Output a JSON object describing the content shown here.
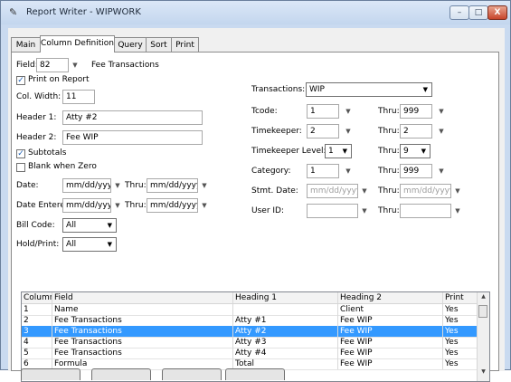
{
  "window": {
    "title": "Report Writer - WIPWORK",
    "min": "–",
    "max": "□",
    "close": "X"
  },
  "tabs": [
    "Main",
    "Column Definition",
    "Query",
    "Sort",
    "Print"
  ],
  "left": {
    "field_label": "Field:",
    "field_value": "82",
    "field_name": "Fee Transactions",
    "print_on_report": "Print on Report",
    "col_width_label": "Col. Width:",
    "col_width": "11",
    "header1_label": "Header 1:",
    "header1": "Atty #2",
    "header2_label": "Header 2:",
    "header2": "Fee WIP",
    "subtotals": "Subtotals",
    "blank_when_zero": "Blank when Zero",
    "date_label": "Date:",
    "date_value": "mm/dd/yyyy",
    "thru_label": "Thru:",
    "date_thru": "mm/dd/yyyy",
    "date_entered_label": "Date Entered:",
    "date_entered": "mm/dd/yyyy",
    "date_entered_thru": "mm/dd/yyyy",
    "bill_code_label": "Bill Code:",
    "bill_code": "All",
    "hold_print_label": "Hold/Print:",
    "hold_print": "All"
  },
  "right": {
    "transactions_label": "Transactions:",
    "transactions": "WIP",
    "tcode_label": "Tcode:",
    "tcode": "1",
    "tcode_thru": "999",
    "timekeeper_label": "Timekeeper:",
    "timekeeper": "2",
    "timekeeper_thru": "2",
    "tk_level_label": "Timekeeper Level:",
    "tk_level": "1",
    "tk_level_thru": "9",
    "category_label": "Category:",
    "category": "1",
    "category_thru": "999",
    "stmt_date_label": "Stmt. Date:",
    "stmt_date": "mm/dd/yyyy",
    "stmt_date_thru": "mm/dd/yyyy",
    "user_id_label": "User ID:",
    "user_id": "",
    "user_id_thru": "",
    "thru_label": "Thru:"
  },
  "grid": {
    "headers": [
      "Column",
      "Field",
      "Heading 1",
      "Heading 2",
      "Print"
    ],
    "rows": [
      [
        "1",
        "Name",
        "",
        "Client",
        "Yes"
      ],
      [
        "2",
        "Fee Transactions",
        "Atty #1",
        "Fee WIP",
        "Yes"
      ],
      [
        "3",
        "Fee Transactions",
        "Atty #2",
        "Fee WIP",
        "Yes"
      ],
      [
        "4",
        "Fee Transactions",
        "Atty #3",
        "Fee WIP",
        "Yes"
      ],
      [
        "5",
        "Fee Transactions",
        "Atty #4",
        "Fee WIP",
        "Yes"
      ],
      [
        "6",
        "Formula",
        "Total",
        "Fee WIP",
        "Yes"
      ]
    ],
    "selected_row": 3
  },
  "icons": {
    "app": "report-writer-icon",
    "dropdown": "chevron-down-icon",
    "check": "checkmark-icon"
  }
}
